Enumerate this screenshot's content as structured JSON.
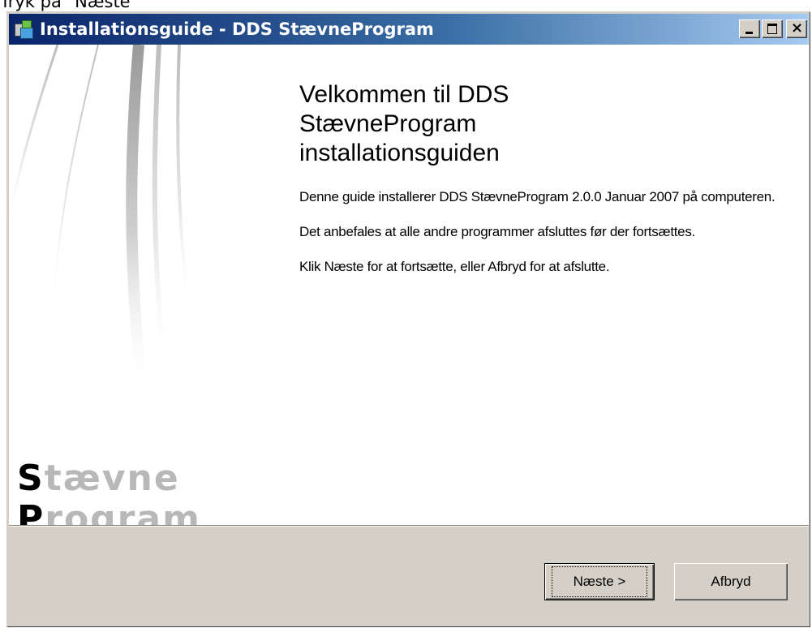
{
  "caption": "Tryk på \"Næste\"",
  "window": {
    "title": "Installationsguide - DDS StævneProgram",
    "controls": {
      "minimize": "minimize",
      "maximize": "maximize",
      "close": "×"
    }
  },
  "logo": {
    "line1_cap": "S",
    "line1_rest": "tævne",
    "line2_cap": "P",
    "line2_rest": "rogram"
  },
  "main": {
    "heading": "Velkommen til DDS StævneProgram installationsguiden",
    "paragraphs": [
      "Denne guide installerer DDS StævneProgram 2.0.0 Januar 2007 på computeren.",
      "Det anbefales at alle andre programmer afsluttes før der fortsættes.",
      "Klik Næste for at fortsætte, eller Afbryd for at afslutte."
    ]
  },
  "buttons": {
    "next": "Næste >",
    "cancel": "Afbryd"
  },
  "colors": {
    "titlebar_start": "#0a246a",
    "titlebar_end": "#a6caf0",
    "face": "#d4d0c8"
  }
}
